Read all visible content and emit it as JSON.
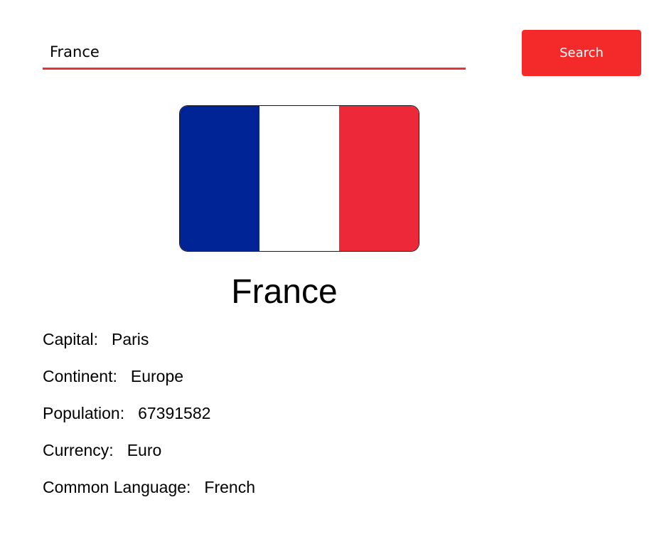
{
  "search": {
    "value": "France",
    "button_label": "Search"
  },
  "flag": {
    "icon": "flag-of-france-icon",
    "stripes": [
      "#002395",
      "#ffffff",
      "#ed2939"
    ]
  },
  "country": {
    "name": "France",
    "details": [
      {
        "label": "Capital:",
        "value": "Paris"
      },
      {
        "label": "Continent:",
        "value": "Europe"
      },
      {
        "label": "Population:",
        "value": "67391582"
      },
      {
        "label": "Currency:",
        "value": "Euro"
      },
      {
        "label": "Common Language:",
        "value": "French"
      }
    ]
  },
  "colors": {
    "accent": "#f42a2a",
    "underline": "#e8323a"
  }
}
